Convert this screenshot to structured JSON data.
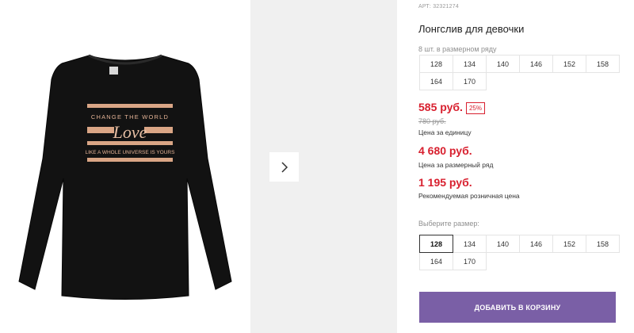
{
  "product": {
    "article": "АРТ: 32321274",
    "title": "Лонгслив для девочки",
    "image": {
      "name": "black-longsleeve-photo",
      "print_line_top": "CHANGE THE WORLD",
      "print_word": "Love",
      "print_line_bottom": "LIKE A WHOLE UNIVERSE IS YOURS"
    }
  },
  "pack": {
    "label": "8 шт. в размерном ряду",
    "sizes": [
      "128",
      "134",
      "140",
      "146",
      "152",
      "158",
      "164",
      "170"
    ]
  },
  "pricing": {
    "unit_price": "585 руб.",
    "discount_badge": "25%",
    "old_price": "780 руб.",
    "unit_label": "Цена за единицу",
    "pack_price": "4 680 руб.",
    "pack_label": "Цена за размерный ряд",
    "rrp": "1 195 руб.",
    "rrp_label": "Рекомендуемая розничная цена"
  },
  "size_select": {
    "label": "Выберите размер:",
    "options": [
      "128",
      "134",
      "140",
      "146",
      "152",
      "158",
      "164",
      "170"
    ],
    "selected": "128"
  },
  "cart": {
    "add_label": "ДОБАВИТЬ В КОРЗИНУ"
  },
  "gallery": {
    "next_icon": "chevron-right-icon"
  },
  "colors": {
    "price_red": "#d8202f",
    "button_purple": "#7a5fa6",
    "next_panel_bg": "#f0f0f0"
  }
}
